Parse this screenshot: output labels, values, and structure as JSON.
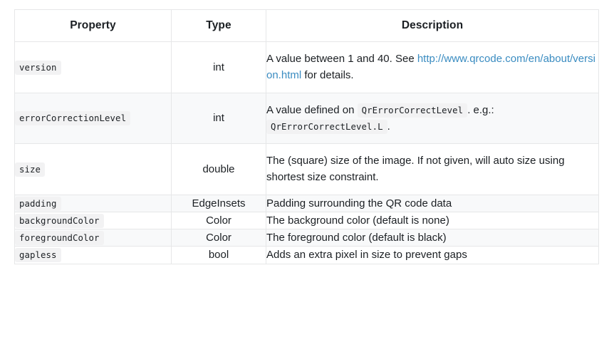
{
  "table": {
    "columns": [
      {
        "id": "property",
        "label": "Property"
      },
      {
        "id": "type",
        "label": "Type"
      },
      {
        "id": "description",
        "label": "Description"
      }
    ],
    "rows": [
      {
        "property": "version",
        "type": "int",
        "description_parts": [
          {
            "kind": "text",
            "value": "A value between 1 and 40. See "
          },
          {
            "kind": "link",
            "value": "http://www.qrcode.com/en/about/version.html"
          },
          {
            "kind": "text",
            "value": " for details."
          }
        ],
        "description_plain": "A value between 1 and 40. See http://www.qrcode.com/en/about/version.html for details.",
        "link": "http://www.qrcode.com/en/about/version.html",
        "desc_lead": "A value between 1 and 40. See ",
        "desc_tail": "for details.",
        "striped": false
      },
      {
        "property": "errorCorrectionLevel",
        "type": "int",
        "description_plain": "A value defined on QrErrorCorrectLevel . e.g.: QrErrorCorrectLevel.L .",
        "desc_lead": "A value defined on ",
        "desc_code_1": "QrErrorCorrectLevel",
        "desc_mid": ". e.g.:",
        "desc_code_2": "QrErrorCorrectLevel.L",
        "desc_tail": ".",
        "striped": true
      },
      {
        "property": "size",
        "type": "double",
        "description_plain": "The (square) size of the image. If not given, will auto size using shortest size constraint.",
        "striped": false
      },
      {
        "property": "padding",
        "type": "EdgeInsets",
        "description_plain": "Padding surrounding the QR code data",
        "striped": true
      },
      {
        "property": "backgroundColor",
        "type": "Color",
        "description_plain": "The background color (default is none)",
        "striped": false
      },
      {
        "property": "foregroundColor",
        "type": "Color",
        "description_plain": "The foreground color (default is black)",
        "striped": true
      },
      {
        "property": "gapless",
        "type": "bool",
        "description_plain": "Adds an extra pixel in size to prevent gaps",
        "striped": false
      }
    ]
  },
  "colors": {
    "page_background": "#ffffff",
    "table_border": "#e6e7e8",
    "stripe_background": "#f8f9fa",
    "code_background": "#f2f2f3",
    "link": "#3a8cc1",
    "text": "#1b1f23"
  }
}
